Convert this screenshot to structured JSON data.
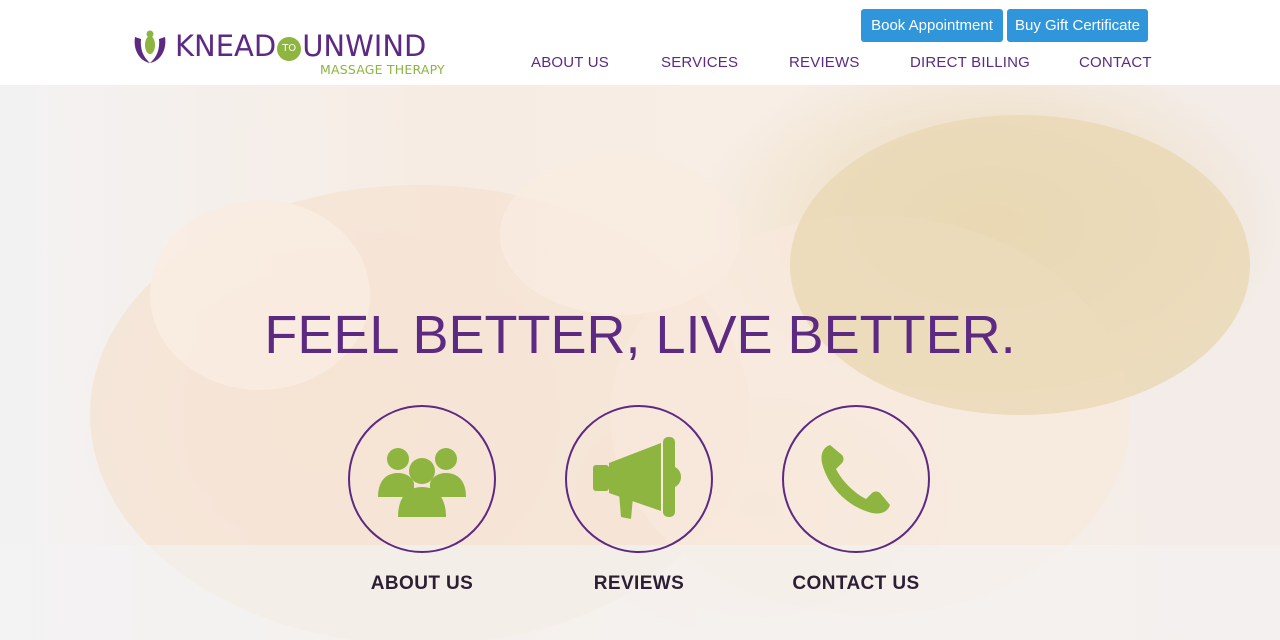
{
  "brand": {
    "name_part1": "KNEAD",
    "name_connector": "TO",
    "name_part2": "UNWIND",
    "tagline": "MASSAGE THERAPY",
    "primary_color": "#5c2a82",
    "accent_color": "#8db53f"
  },
  "header": {
    "buttons": {
      "book": "Book Appointment",
      "gift": "Buy Gift Certificate",
      "button_color": "#2f96dc"
    },
    "nav": [
      "ABOUT US",
      "SERVICES",
      "REVIEWS",
      "DIRECT BILLING",
      "CONTACT"
    ]
  },
  "hero": {
    "headline": "FEEL BETTER, LIVE BETTER.",
    "features": [
      {
        "label": "ABOUT US",
        "icon": "people-icon"
      },
      {
        "label": "REVIEWS",
        "icon": "megaphone-icon"
      },
      {
        "label": "CONTACT US",
        "icon": "phone-icon"
      }
    ]
  }
}
